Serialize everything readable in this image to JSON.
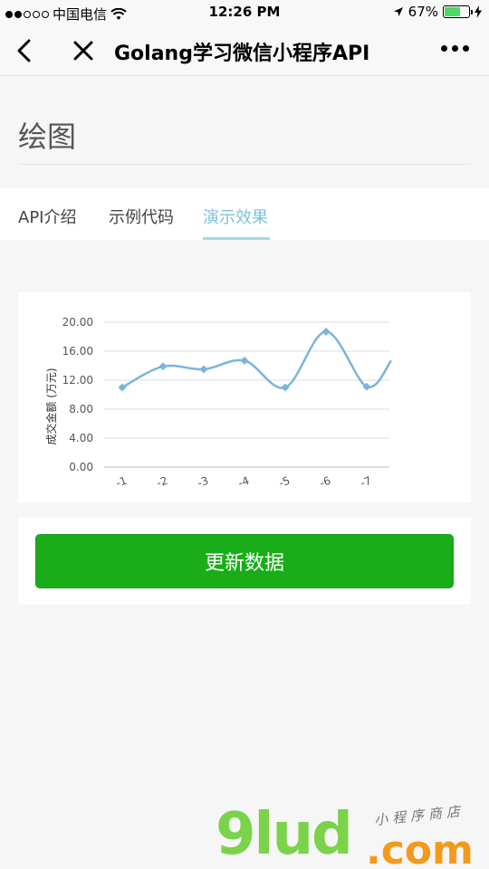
{
  "status_bar": {
    "carrier": "中国电信",
    "time": "12:26 PM",
    "battery": "67%",
    "battery_level": 0.67,
    "icons": [
      "signal-dots-icon",
      "wifi-icon",
      "location-arrow-icon",
      "battery-icon",
      "charging-bolt-icon"
    ]
  },
  "nav": {
    "title": "Golang学习微信小程序API",
    "icons": [
      "back-icon",
      "close-icon",
      "more-icon"
    ]
  },
  "page": {
    "title": "绘图"
  },
  "tabs": [
    {
      "label": "API介绍",
      "active": false
    },
    {
      "label": "示例代码",
      "active": false
    },
    {
      "label": "演示效果",
      "active": true
    }
  ],
  "colors": {
    "accent_tab": "#7fc2d8",
    "button_green": "#1aad19",
    "line_series": "#7cb5d9"
  },
  "chart_data": {
    "type": "line",
    "ylabel": "成交金额 (万元)",
    "ylim": [
      0,
      20
    ],
    "yticks": [
      "0.00",
      "4.00",
      "8.00",
      "12.00",
      "16.00",
      "20.00"
    ],
    "x_ticks": [
      "-1",
      "-2",
      "-3",
      "-4",
      "-5",
      "-6",
      "-7"
    ],
    "values": [
      11.0,
      13.9,
      13.5,
      14.7,
      11.0,
      18.7,
      11.1,
      14.7
    ],
    "grid": true,
    "curve": "smooth"
  },
  "button": {
    "label": "更新数据"
  },
  "watermark": {
    "logo": "9lud",
    "suffix": ".com",
    "tagline": "小程序商店"
  }
}
